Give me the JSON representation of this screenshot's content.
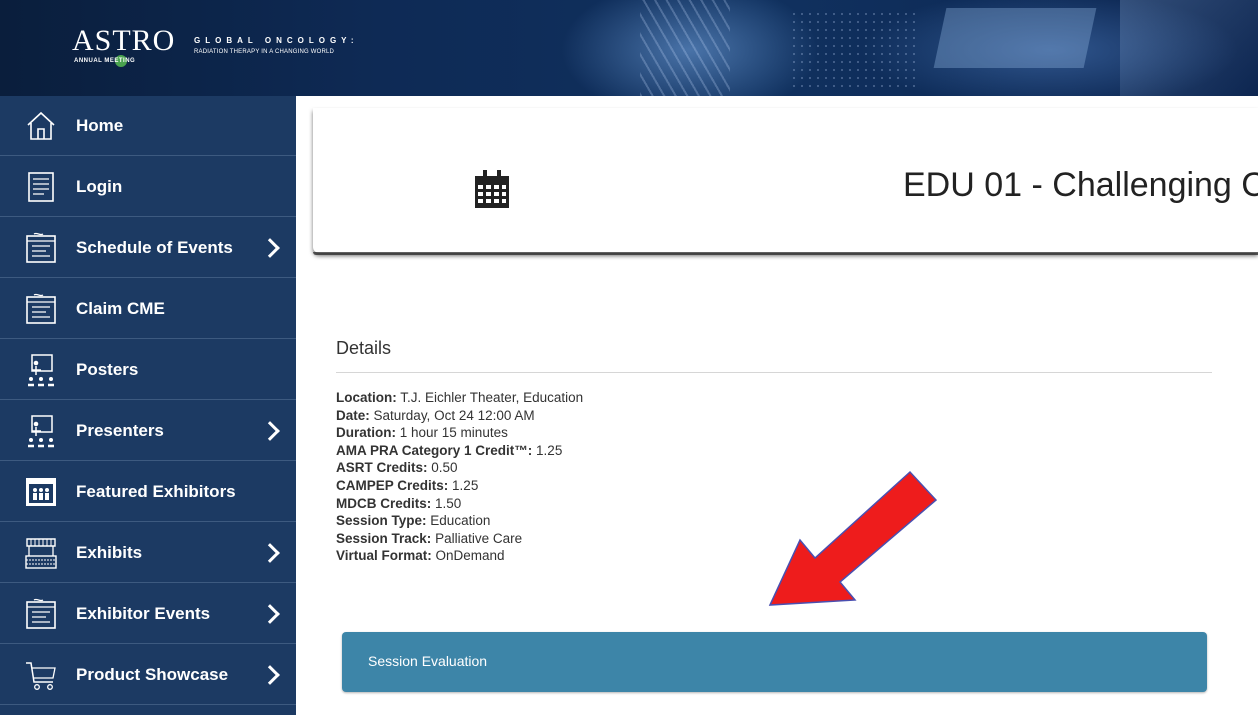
{
  "banner": {
    "logo_word": "ASTRO",
    "logo_sub": "ANNUAL      MEETING",
    "tagline_top": "GLOBAL ONCOLOGY:",
    "tagline_bottom": "RADIATION THERAPY IN A CHANGING WORLD"
  },
  "sidebar": {
    "items": [
      {
        "label": "Home",
        "icon": "home-icon",
        "chevron": false
      },
      {
        "label": "Login",
        "icon": "login-icon",
        "chevron": false
      },
      {
        "label": "Schedule of Events",
        "icon": "schedule-icon",
        "chevron": true
      },
      {
        "label": "Claim CME",
        "icon": "schedule-icon",
        "chevron": false
      },
      {
        "label": "Posters",
        "icon": "presenter-icon",
        "chevron": false
      },
      {
        "label": "Presenters",
        "icon": "presenter-icon",
        "chevron": true
      },
      {
        "label": "Featured Exhibitors",
        "icon": "exhibitors-icon",
        "chevron": false
      },
      {
        "label": "Exhibits",
        "icon": "booth-icon",
        "chevron": true
      },
      {
        "label": "Exhibitor Events",
        "icon": "schedule-icon",
        "chevron": true
      },
      {
        "label": "Product Showcase",
        "icon": "cart-icon",
        "chevron": true
      }
    ]
  },
  "session": {
    "title": "EDU 01 - Challenging C",
    "icon": "calendar-icon"
  },
  "details": {
    "heading": "Details",
    "rows": [
      {
        "label": "Location:",
        "value": "T.J. Eichler Theater, Education"
      },
      {
        "label": "Date:",
        "value": "Saturday, Oct 24 12:00 AM"
      },
      {
        "label": "Duration:",
        "value": "1 hour 15 minutes"
      },
      {
        "label": "AMA PRA Category 1 Credit™:",
        "value": "1.25"
      },
      {
        "label": "ASRT Credits:",
        "value": "0.50"
      },
      {
        "label": "CAMPEP Credits:",
        "value": "1.25"
      },
      {
        "label": "MDCB Credits:",
        "value": "1.50"
      },
      {
        "label": "Session Type:",
        "value": "Education"
      },
      {
        "label": "Session Track:",
        "value": "Palliative Care"
      },
      {
        "label": "Virtual Format:",
        "value": "OnDemand"
      }
    ]
  },
  "evaluation": {
    "label": "Session Evaluation"
  },
  "colors": {
    "sidebar_bg": "#1c3a63",
    "eval_button": "#3d85a8",
    "annotation_arrow": "#ee1c1c"
  }
}
